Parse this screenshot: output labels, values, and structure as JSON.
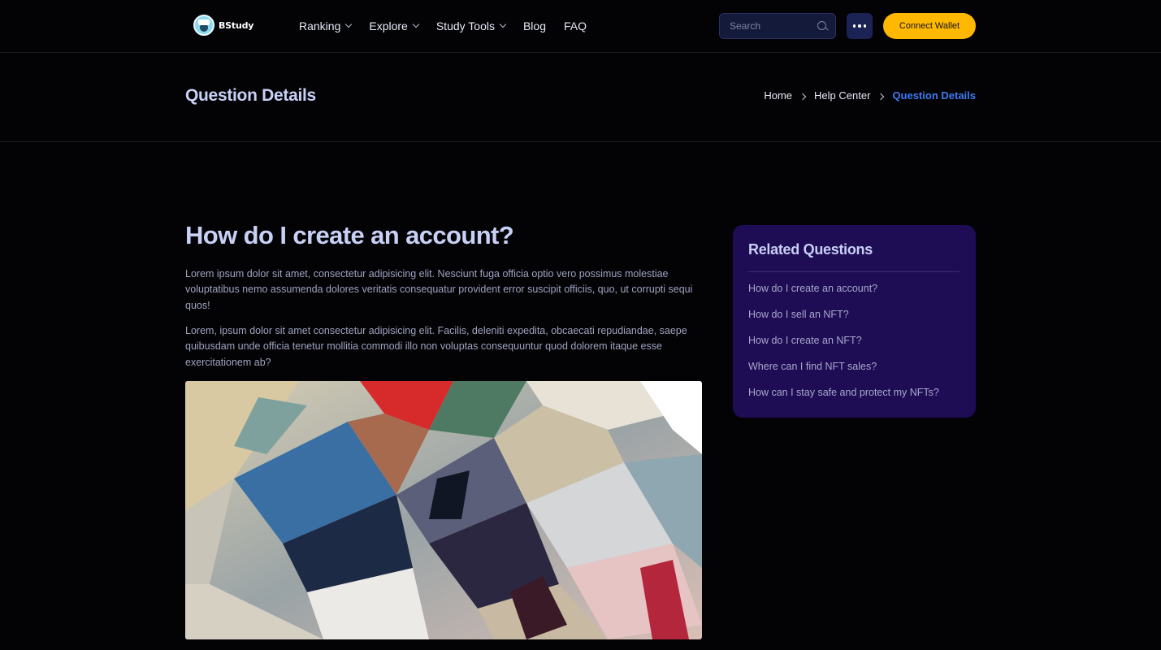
{
  "brand": {
    "name": "BStudy"
  },
  "nav": {
    "items": [
      {
        "label": "Ranking",
        "dropdown": true
      },
      {
        "label": "Explore",
        "dropdown": true
      },
      {
        "label": "Study Tools",
        "dropdown": true
      },
      {
        "label": "Blog",
        "dropdown": false
      },
      {
        "label": "FAQ",
        "dropdown": false
      }
    ]
  },
  "header": {
    "search_placeholder": "Search",
    "connect_wallet_label": "Connect Wallet"
  },
  "page": {
    "title": "Question Details",
    "breadcrumb": [
      "Home",
      "Help Center",
      "Question Details"
    ]
  },
  "article": {
    "title": "How do I create an account?",
    "paragraphs": [
      "Lorem ipsum dolor sit amet, consectetur adipisicing elit. Nesciunt fuga officia optio vero possimus molestiae voluptatibus nemo assumenda dolores veritatis consequatur provident error suscipit officiis, quo, ut corrupti sequi quos!",
      "Lorem, ipsum dolor sit amet consectetur adipisicing elit. Facilis, deleniti expedita, obcaecati repudiandae, saepe quibusdam unde officia tenetur mollitia commodi illo non voluptas consequuntur quod dolorem itaque esse exercitationem ab?"
    ]
  },
  "related": {
    "title": "Related Questions",
    "items": [
      "How do I create an account?",
      "How do I sell an NFT?",
      "How do I create an NFT?",
      "Where can I find NFT sales?",
      "How can I stay safe and protect my NFTs?"
    ]
  },
  "colors": {
    "background": "#030306",
    "accent_yellow": "#ffb800",
    "accent_blue": "#3d7bf2",
    "sidebar_bg": "#1e0c54",
    "heading": "#c8d0f5"
  }
}
